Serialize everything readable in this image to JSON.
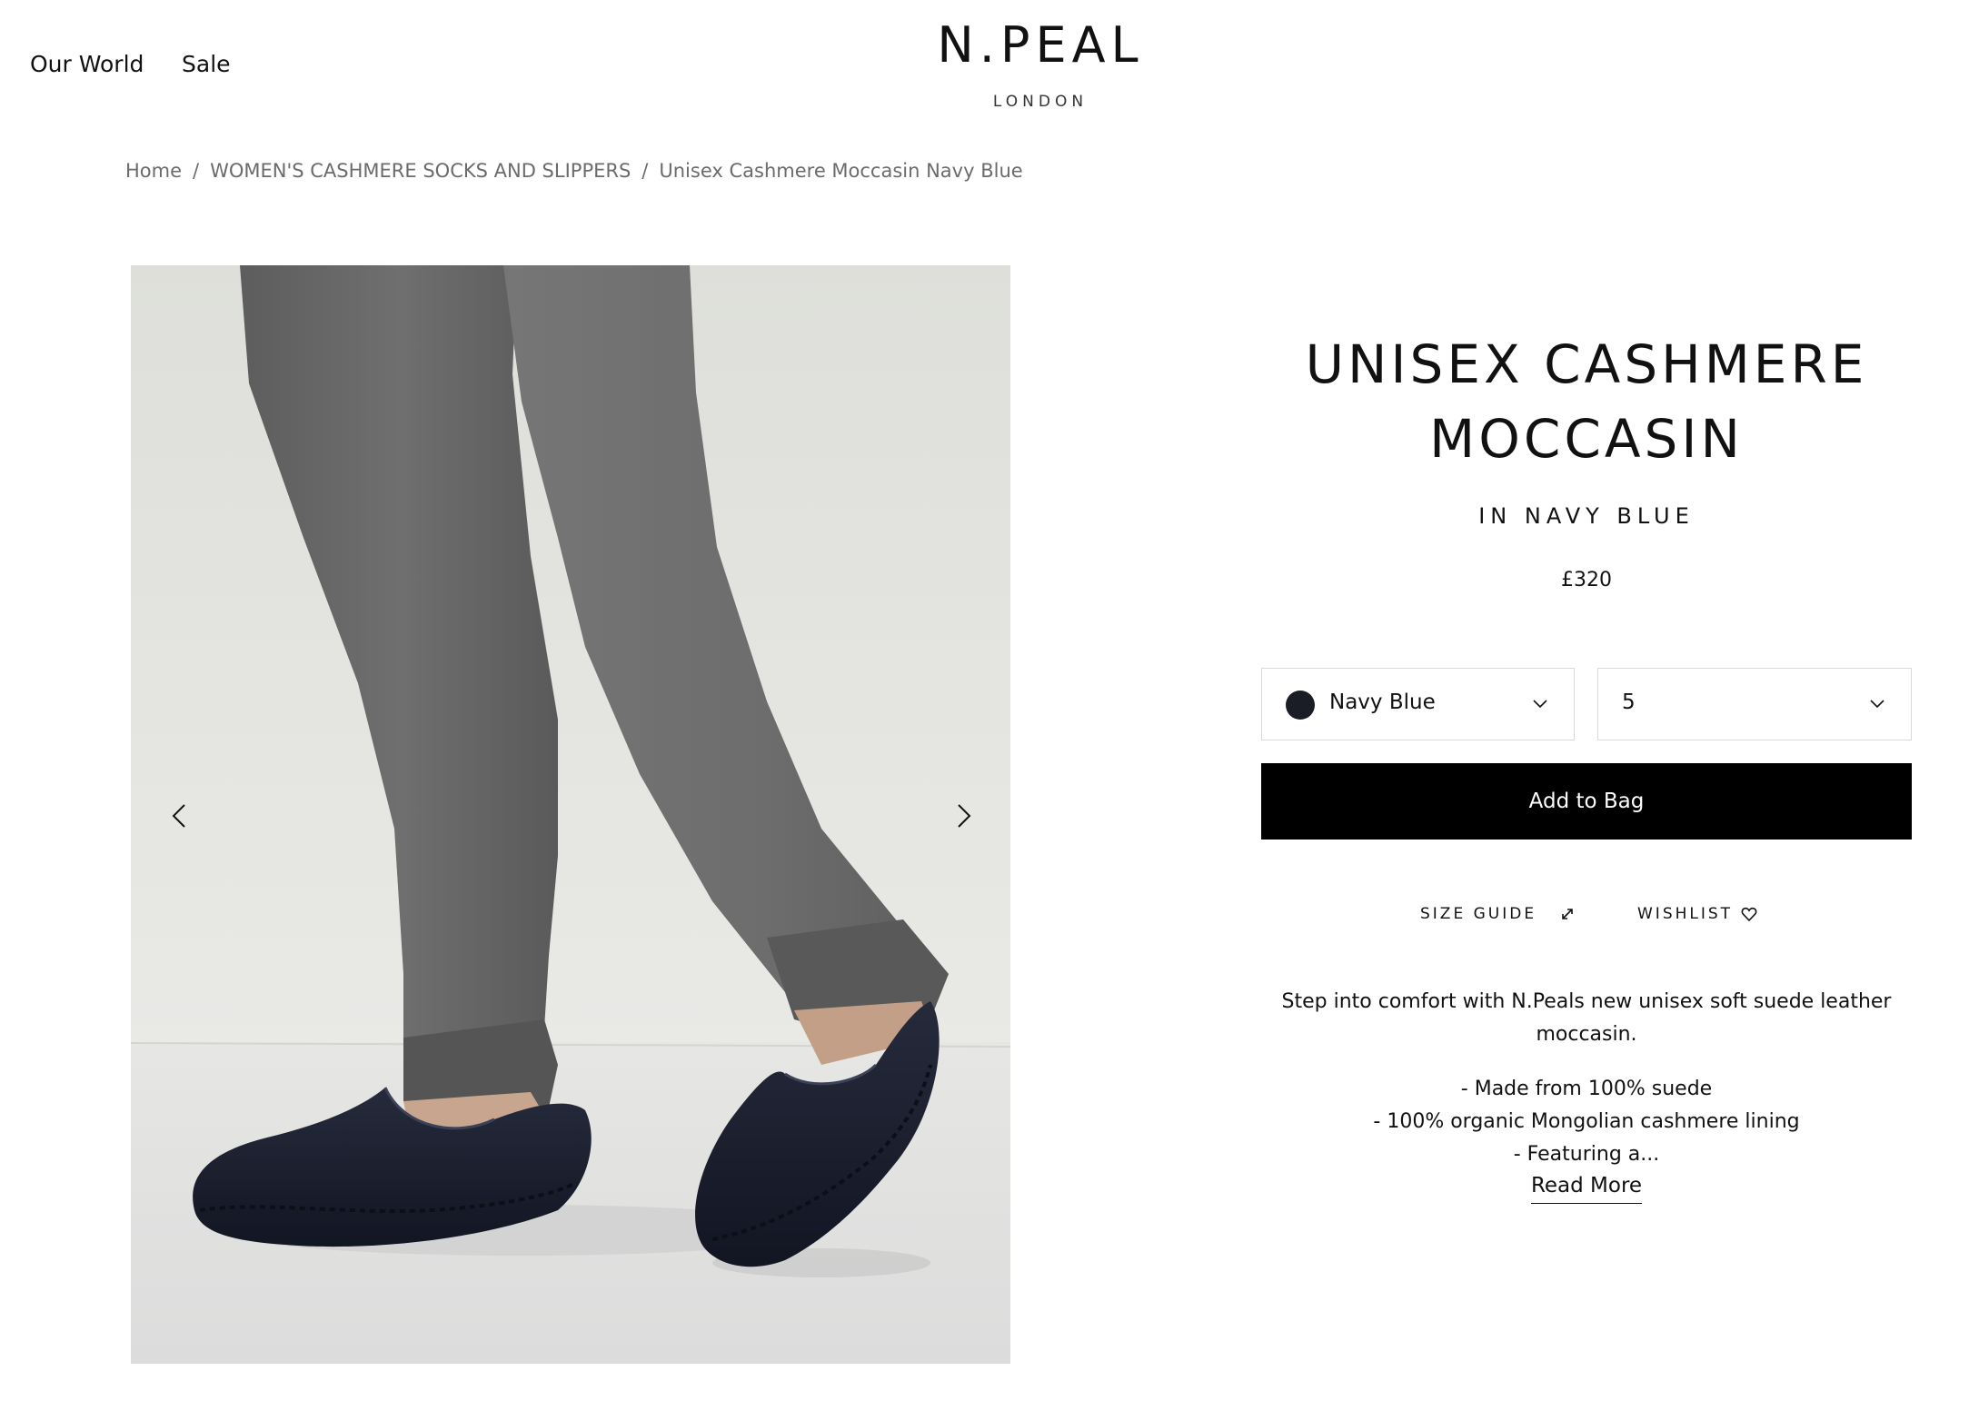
{
  "header": {
    "nav": [
      {
        "label": "Our World"
      },
      {
        "label": "Sale"
      }
    ],
    "logo": {
      "brand": "N.PEAL",
      "sub": "LONDON"
    }
  },
  "breadcrumb": [
    {
      "label": "Home"
    },
    {
      "label": "WOMEN'S CASHMERE SOCKS AND SLIPPERS"
    },
    {
      "label": "Unisex Cashmere Moccasin Navy Blue"
    }
  ],
  "breadcrumb_separator": "/",
  "gallery": {
    "image": "navy-suede-moccasins-grey-joggers-photo",
    "prev_icon": "chevron-left-icon",
    "next_icon": "chevron-right-icon"
  },
  "product": {
    "title": "UNISEX CASHMERE MOCCASIN",
    "subtitle": "IN NAVY BLUE",
    "price": "£320",
    "color_select": {
      "value": "Navy Blue",
      "swatch_color": "#1a1d26",
      "icon": "chevron-down-icon"
    },
    "size_select": {
      "value": "5",
      "icon": "chevron-down-icon"
    },
    "add_to_bag_label": "Add to Bag",
    "size_guide_label": "SIZE GUIDE",
    "size_guide_icon": "ruler-icon",
    "wishlist_label": "WISHLIST",
    "wishlist_icon": "heart-icon",
    "description": {
      "intro": "Step into comfort with N.Peals new unisex soft suede leather moccasin.",
      "bullets": [
        "- Made from 100% suede",
        "- 100% organic Mongolian cashmere lining",
        "- Featuring a..."
      ]
    },
    "read_more_label": "Read More"
  },
  "colors": {
    "accent": "#000000",
    "text": "#111111",
    "muted": "#6b6b6b",
    "border": "#d9d9d9"
  }
}
